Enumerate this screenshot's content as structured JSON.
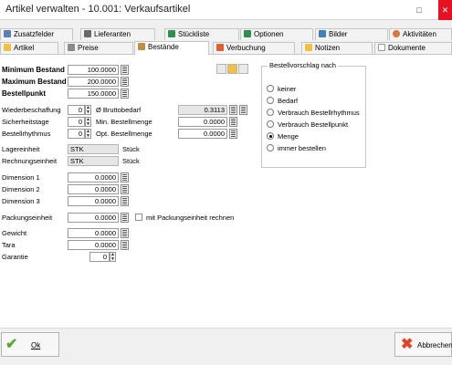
{
  "window": {
    "title": "Artikel verwalten - 10.001: Verkaufsartikel",
    "max_glyph": "□",
    "close_glyph": "✕"
  },
  "tabs_row1": [
    {
      "label": "Zusatzfelder",
      "icon": "fields-icon",
      "color": "#5b7fb5"
    },
    {
      "label": "Lieferanten",
      "icon": "supplier-icon",
      "color": "#6a6a6a"
    },
    {
      "label": "Stückliste",
      "icon": "bom-icon",
      "color": "#2d8f4e"
    },
    {
      "label": "Optionen",
      "icon": "options-icon",
      "color": "#2d8f4e"
    },
    {
      "label": "Bilder",
      "icon": "image-icon",
      "color": "#3d7fc4"
    },
    {
      "label": "Aktivitäten",
      "icon": "heart-icon",
      "color": "#d9773b"
    }
  ],
  "tabs_row2": [
    {
      "label": "Artikel",
      "icon": "article-icon",
      "color": "#f0c040"
    },
    {
      "label": "Preise",
      "icon": "price-icon",
      "color": "#8a8a8a"
    },
    {
      "label": "Bestände",
      "icon": "stock-icon",
      "color": "#c09040"
    },
    {
      "label": "Verbuchung",
      "icon": "booking-icon",
      "color": "#e06030"
    },
    {
      "label": "Notizen",
      "icon": "notes-icon",
      "color": "#f0c040"
    },
    {
      "label": "Dokumente",
      "icon": "document-icon",
      "color": "#dddddd"
    }
  ],
  "form": {
    "min_label": "Minimum Bestand",
    "min_value": "100.0000",
    "max_label": "Maximum Bestand",
    "max_value": "200.0000",
    "order_label": "Bestellpunkt",
    "order_value": "150.0000",
    "repl_label": "Wiederbeschaffung",
    "repl_value": "0",
    "safety_label": "Sicherheitstage",
    "safety_value": "0",
    "rhythm_label": "Bestellrhythmus",
    "rhythm_value": "0",
    "gross_label": "Ø Bruttobedarf",
    "gross_value": "0.3113",
    "minqty_label": "Min. Bestellmenge",
    "minqty_value": "0.0000",
    "optqty_label": "Opt. Bestellmenge",
    "optqty_value": "0.0000",
    "stock_unit_label": "Lagereinheit",
    "stock_unit_value": "STK",
    "stock_unit_text": "Stück",
    "calc_unit_label": "Rechnungseinheit",
    "calc_unit_value": "STK",
    "calc_unit_text": "Stück",
    "dim1_label": "Dimension 1",
    "dim1_value": "0.0000",
    "dim2_label": "Dimension 2",
    "dim2_value": "0.0000",
    "dim3_label": "Dimension 3",
    "dim3_value": "0.0000",
    "pack_label": "Packungseinheit",
    "pack_value": "0.0000",
    "pack_check_label": "mit Packungseinheit rechnen",
    "weight_label": "Gewicht",
    "weight_value": "0.0000",
    "tara_label": "Tara",
    "tara_value": "0.0000",
    "warranty_label": "Garantie",
    "warranty_value": "0"
  },
  "suggestion": {
    "title": "Bestellvorschlag nach",
    "options": [
      "keiner",
      "Bedarf",
      "Verbrauch Bestellrhythmus",
      "Verbrauch Bestellpunkt",
      "Menge",
      "immer bestellen"
    ],
    "selected": "Menge"
  },
  "buttons": {
    "ok": "Ok",
    "cancel": "Abbrechen",
    "ok_color": "#5aa832",
    "cancel_color": "#e0452a"
  }
}
